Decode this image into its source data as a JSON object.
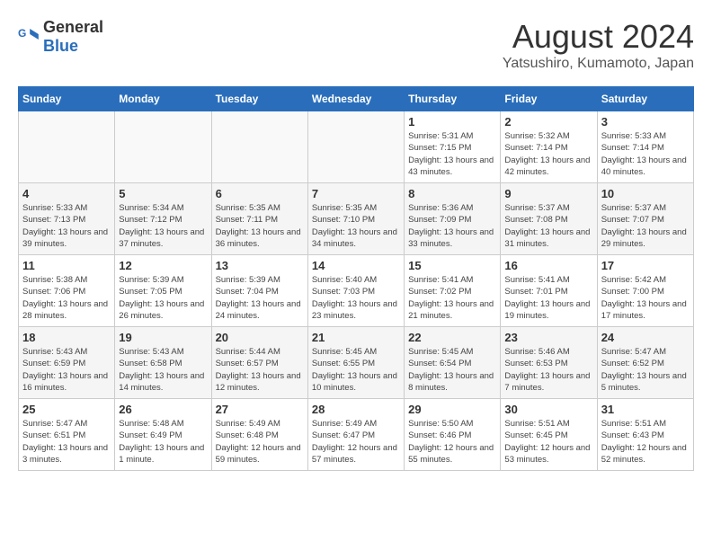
{
  "header": {
    "logo_general": "General",
    "logo_blue": "Blue",
    "month_year": "August 2024",
    "location": "Yatsushiro, Kumamoto, Japan"
  },
  "weekdays": [
    "Sunday",
    "Monday",
    "Tuesday",
    "Wednesday",
    "Thursday",
    "Friday",
    "Saturday"
  ],
  "weeks": [
    {
      "id": "week1",
      "days": [
        {
          "date": "",
          "empty": true
        },
        {
          "date": "",
          "empty": true
        },
        {
          "date": "",
          "empty": true
        },
        {
          "date": "",
          "empty": true
        },
        {
          "date": "1",
          "sunrise": "5:31 AM",
          "sunset": "7:15 PM",
          "daylight": "13 hours and 43 minutes."
        },
        {
          "date": "2",
          "sunrise": "5:32 AM",
          "sunset": "7:14 PM",
          "daylight": "13 hours and 42 minutes."
        },
        {
          "date": "3",
          "sunrise": "5:33 AM",
          "sunset": "7:14 PM",
          "daylight": "13 hours and 40 minutes."
        }
      ]
    },
    {
      "id": "week2",
      "days": [
        {
          "date": "4",
          "sunrise": "5:33 AM",
          "sunset": "7:13 PM",
          "daylight": "13 hours and 39 minutes."
        },
        {
          "date": "5",
          "sunrise": "5:34 AM",
          "sunset": "7:12 PM",
          "daylight": "13 hours and 37 minutes."
        },
        {
          "date": "6",
          "sunrise": "5:35 AM",
          "sunset": "7:11 PM",
          "daylight": "13 hours and 36 minutes."
        },
        {
          "date": "7",
          "sunrise": "5:35 AM",
          "sunset": "7:10 PM",
          "daylight": "13 hours and 34 minutes."
        },
        {
          "date": "8",
          "sunrise": "5:36 AM",
          "sunset": "7:09 PM",
          "daylight": "13 hours and 33 minutes."
        },
        {
          "date": "9",
          "sunrise": "5:37 AM",
          "sunset": "7:08 PM",
          "daylight": "13 hours and 31 minutes."
        },
        {
          "date": "10",
          "sunrise": "5:37 AM",
          "sunset": "7:07 PM",
          "daylight": "13 hours and 29 minutes."
        }
      ]
    },
    {
      "id": "week3",
      "days": [
        {
          "date": "11",
          "sunrise": "5:38 AM",
          "sunset": "7:06 PM",
          "daylight": "13 hours and 28 minutes."
        },
        {
          "date": "12",
          "sunrise": "5:39 AM",
          "sunset": "7:05 PM",
          "daylight": "13 hours and 26 minutes."
        },
        {
          "date": "13",
          "sunrise": "5:39 AM",
          "sunset": "7:04 PM",
          "daylight": "13 hours and 24 minutes."
        },
        {
          "date": "14",
          "sunrise": "5:40 AM",
          "sunset": "7:03 PM",
          "daylight": "13 hours and 23 minutes."
        },
        {
          "date": "15",
          "sunrise": "5:41 AM",
          "sunset": "7:02 PM",
          "daylight": "13 hours and 21 minutes."
        },
        {
          "date": "16",
          "sunrise": "5:41 AM",
          "sunset": "7:01 PM",
          "daylight": "13 hours and 19 minutes."
        },
        {
          "date": "17",
          "sunrise": "5:42 AM",
          "sunset": "7:00 PM",
          "daylight": "13 hours and 17 minutes."
        }
      ]
    },
    {
      "id": "week4",
      "days": [
        {
          "date": "18",
          "sunrise": "5:43 AM",
          "sunset": "6:59 PM",
          "daylight": "13 hours and 16 minutes."
        },
        {
          "date": "19",
          "sunrise": "5:43 AM",
          "sunset": "6:58 PM",
          "daylight": "13 hours and 14 minutes."
        },
        {
          "date": "20",
          "sunrise": "5:44 AM",
          "sunset": "6:57 PM",
          "daylight": "13 hours and 12 minutes."
        },
        {
          "date": "21",
          "sunrise": "5:45 AM",
          "sunset": "6:55 PM",
          "daylight": "13 hours and 10 minutes."
        },
        {
          "date": "22",
          "sunrise": "5:45 AM",
          "sunset": "6:54 PM",
          "daylight": "13 hours and 8 minutes."
        },
        {
          "date": "23",
          "sunrise": "5:46 AM",
          "sunset": "6:53 PM",
          "daylight": "13 hours and 7 minutes."
        },
        {
          "date": "24",
          "sunrise": "5:47 AM",
          "sunset": "6:52 PM",
          "daylight": "13 hours and 5 minutes."
        }
      ]
    },
    {
      "id": "week5",
      "days": [
        {
          "date": "25",
          "sunrise": "5:47 AM",
          "sunset": "6:51 PM",
          "daylight": "13 hours and 3 minutes."
        },
        {
          "date": "26",
          "sunrise": "5:48 AM",
          "sunset": "6:49 PM",
          "daylight": "13 hours and 1 minute."
        },
        {
          "date": "27",
          "sunrise": "5:49 AM",
          "sunset": "6:48 PM",
          "daylight": "12 hours and 59 minutes."
        },
        {
          "date": "28",
          "sunrise": "5:49 AM",
          "sunset": "6:47 PM",
          "daylight": "12 hours and 57 minutes."
        },
        {
          "date": "29",
          "sunrise": "5:50 AM",
          "sunset": "6:46 PM",
          "daylight": "12 hours and 55 minutes."
        },
        {
          "date": "30",
          "sunrise": "5:51 AM",
          "sunset": "6:45 PM",
          "daylight": "12 hours and 53 minutes."
        },
        {
          "date": "31",
          "sunrise": "5:51 AM",
          "sunset": "6:43 PM",
          "daylight": "12 hours and 52 minutes."
        }
      ]
    }
  ],
  "labels": {
    "sunrise": "Sunrise:",
    "sunset": "Sunset:",
    "daylight": "Daylight:"
  }
}
